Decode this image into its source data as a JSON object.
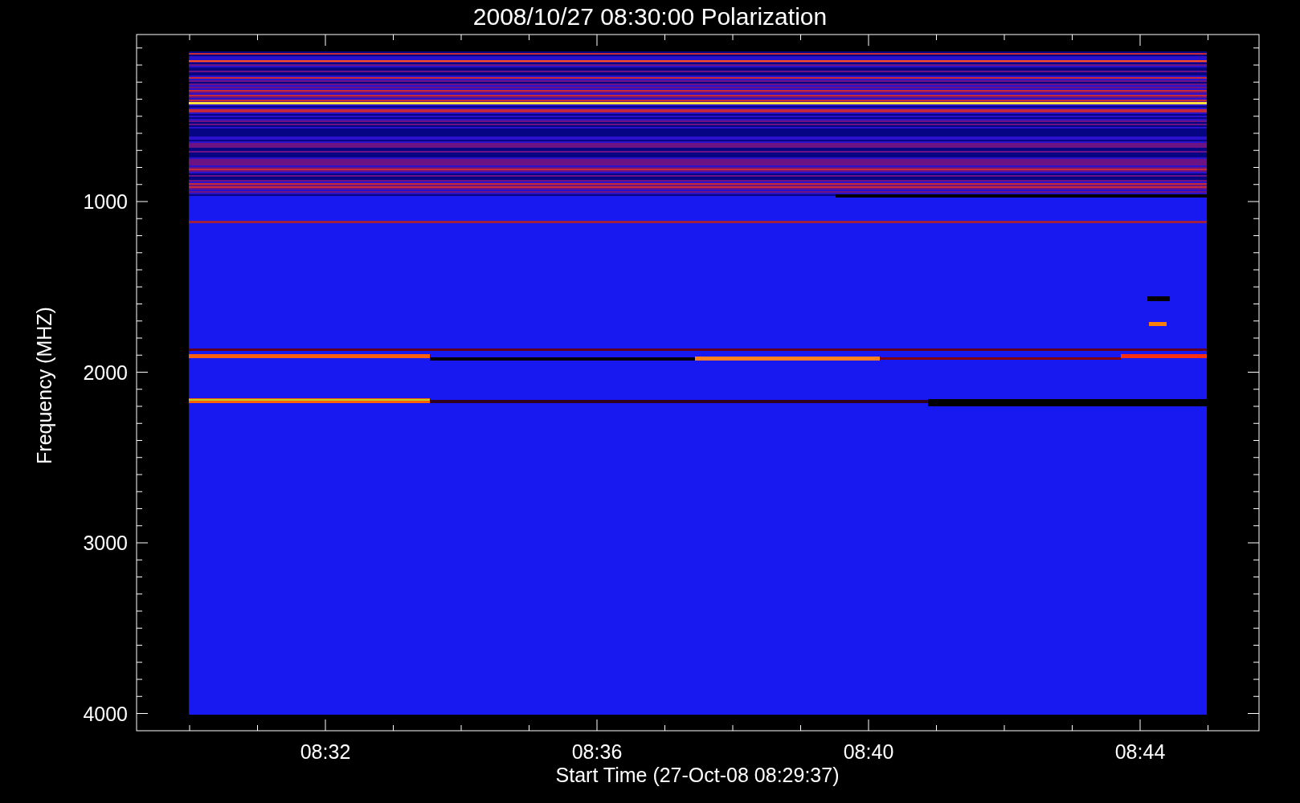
{
  "title": "2008/10/27 08:30:00 Polarization",
  "y_axis": {
    "label": "Frequency (MHZ)",
    "tick_labels": [
      "1000",
      "2000",
      "3000",
      "4000"
    ]
  },
  "x_axis": {
    "label": "Start Time (27-Oct-08 08:29:37)",
    "tick_labels": [
      "08:32",
      "08:36",
      "08:40",
      "08:44"
    ]
  }
}
